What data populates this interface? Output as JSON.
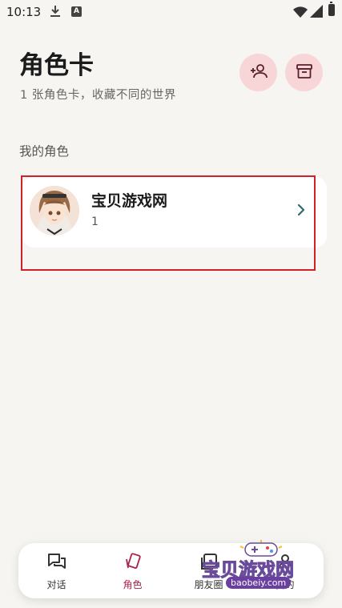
{
  "status_bar": {
    "time": "10:13",
    "icons": [
      "download-icon",
      "a-icon",
      "wifi-icon",
      "signal-icon",
      "battery-icon"
    ]
  },
  "header": {
    "title": "角色卡",
    "subtitle": "1 张角色卡，收藏不同的世界",
    "actions": [
      "add-person-icon",
      "archive-icon"
    ]
  },
  "section": {
    "label": "我的角色"
  },
  "characters": [
    {
      "name": "宝贝游戏网",
      "count": "1"
    }
  ],
  "bottom_nav": {
    "items": [
      {
        "label": "对话",
        "icon": "chat-icon"
      },
      {
        "label": "角色",
        "icon": "cards-icon",
        "active": true
      },
      {
        "label": "朋友圈",
        "icon": "moments-icon"
      },
      {
        "label": "我的",
        "icon": "me-icon"
      }
    ]
  },
  "watermark": {
    "text": "宝贝游戏网",
    "url": "baobeiy.com"
  },
  "colors": {
    "background": "#f6f5f1",
    "accent": "#a8224a",
    "button_bg": "#f8d6d8",
    "highlight": "#d0202a",
    "chevron": "#2e6b6b"
  }
}
